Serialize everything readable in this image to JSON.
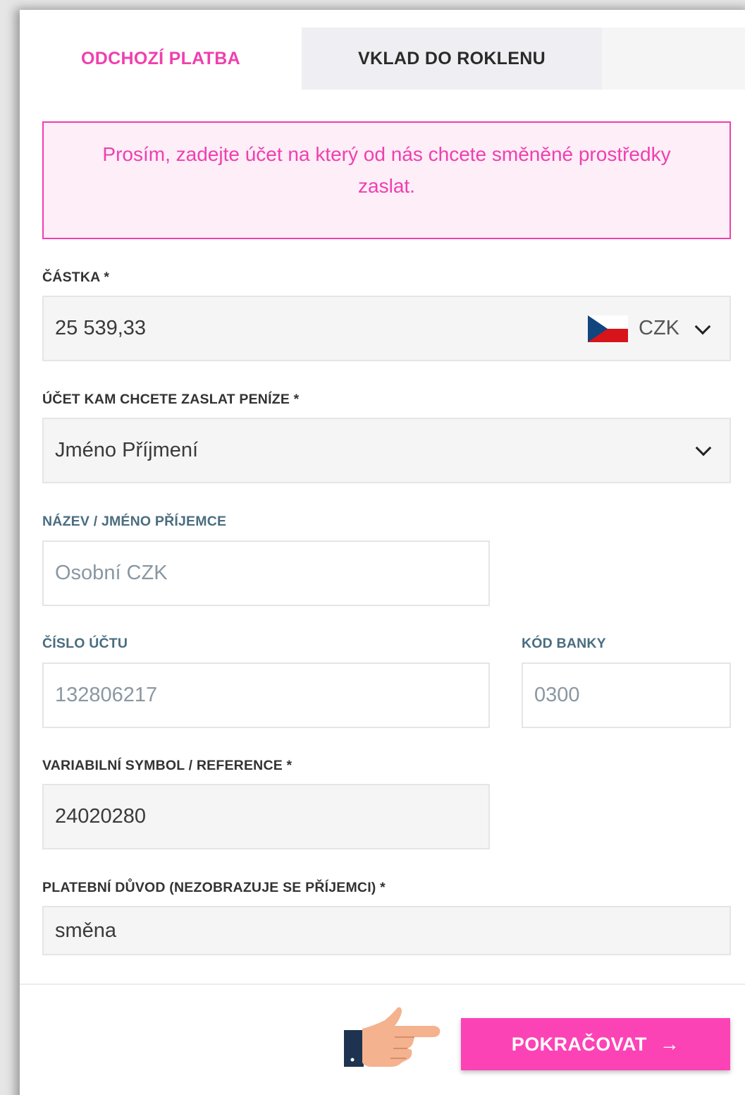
{
  "tabs": {
    "outgoing_label": "ODCHOZÍ PLATBA",
    "deposit_label": "VKLAD DO ROKLENU"
  },
  "alert": {
    "message": "Prosím, zadejte účet na který od nás chcete směněné prostředky zaslat."
  },
  "amount": {
    "label": "ČÁSTKA *",
    "value": "25 539,33",
    "currency": "CZK",
    "currency_flag": "czech-flag"
  },
  "account": {
    "label": "ÚČET KAM CHCETE ZASLAT PENÍZE *",
    "value": "Jméno Příjmení"
  },
  "recipient_name": {
    "label": "NÁZEV / JMÉNO PŘÍJEMCE",
    "placeholder": "Osobní CZK"
  },
  "account_number": {
    "label": "ČÍSLO ÚČTU",
    "placeholder": "132806217"
  },
  "bank_code": {
    "label": "KÓD BANKY",
    "placeholder": "0300"
  },
  "variable_symbol": {
    "label": "VARIABILNÍ SYMBOL / REFERENCE *",
    "value": "24020280"
  },
  "payment_reason": {
    "label": "PLATEBNÍ DŮVOD (NEZOBRAZUJE SE PŘÍJEMCI) *",
    "value": "směna"
  },
  "continue_button": {
    "label": "POKRAČOVAT",
    "icon": "arrow-right-icon"
  },
  "colors": {
    "accent": "#f03fae",
    "button": "#fc43b6",
    "alert_bg": "#fdeef8",
    "field_bg": "#f5f5f6"
  }
}
